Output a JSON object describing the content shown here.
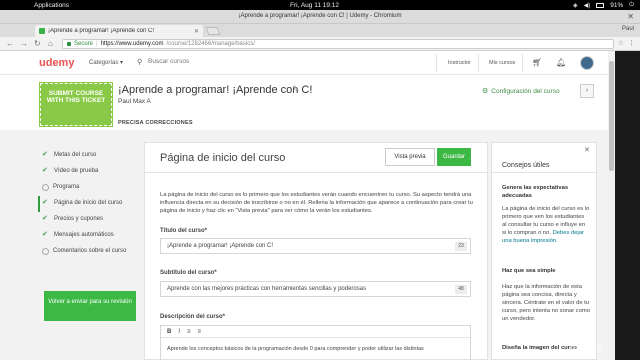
{
  "system_bar": {
    "apps": "Applications",
    "clock": "Fri, Aug 11   19:12",
    "battery": "91%"
  },
  "window": {
    "title": "¡Aprende a programar! ¡Aprende con C! | Udemy - Chromium"
  },
  "browser": {
    "tab_title": "¡Aprende a programar! ¡Aprende con C!",
    "profile": "Paul",
    "secure_label": "Secure",
    "url_host": "https://www.udemy.com",
    "url_path": "/course/1282466/manage/basics/"
  },
  "udemy_header": {
    "logo": "udemy",
    "categories": "Categorías ▾",
    "search_placeholder": "Buscar cursos",
    "instructor": "Instructor",
    "my_courses": "Mis cursos"
  },
  "course": {
    "badge": "SUBMIT COURSE WITH THIS TICKET",
    "title": "¡Aprende a programar! ¡Aprende con C!",
    "author": "Paul Max A",
    "status": "PRECISA CORRECCIONES",
    "config_link": "Configuración del curso"
  },
  "sidebar": {
    "items": [
      {
        "label": "Metas del curso",
        "done": true
      },
      {
        "label": "Vídeo de prueba",
        "done": true
      },
      {
        "label": "Programa",
        "done": false
      },
      {
        "label": "Página de inicio del curso",
        "done": true,
        "active": true
      },
      {
        "label": "Precios y cupones",
        "done": true
      },
      {
        "label": "Mensajes automáticos",
        "done": true
      },
      {
        "label": "Comentarios sobre el curso",
        "done": false
      }
    ],
    "submit_button": "Volver a enviar para su revisión"
  },
  "main": {
    "title": "Página de inicio del curso",
    "preview_button": "Vista previa",
    "save_button": "Guardar",
    "intro": "La página de inicio del curso es lo primero que los estudiantes verán cuando encuentren tu curso. Su aspecto tendrá una influencia directa en su decisión de inscribirse o no en él. Rellena la información que aparece a continuación para crear tu página de inicio y haz clic en \"Vista previa\" para ver cómo la verán los estudiantes.",
    "title_label": "Título del curso*",
    "title_value": "¡Aprende a programar! ¡Aprende con C!",
    "title_count": "23",
    "subtitle_label": "Subtítulo del curso*",
    "subtitle_value": "Aprende con las mejores prácticas con herramientas sencillas y poderosas",
    "subtitle_count": "48",
    "description_label": "Descripción del curso*",
    "editor_tools": [
      "B",
      "I",
      "≡",
      "≡"
    ],
    "description_value": "Aprende los conceptos básicos de la programación desde 0 para comprender y poder utilizar las distintas"
  },
  "tips": {
    "title": "Consejos útiles",
    "h1": "Genera las expectativas adecuadas",
    "p1": "La página de inicio del curso es lo primero que ven los estudiantes al consultar tu curso e influye en si lo compran o no.",
    "p1_link": "Debes dejar una buena impresión.",
    "h2": "Haz que sea simple",
    "p2": "Haz que la información de esta página sea concisa, directa y sincera. Céntrate en el valor de tu curso, pero intenta no sonar como un vendedor.",
    "h3": "Diseña la imagen del curso"
  },
  "watermark": "udemy"
}
